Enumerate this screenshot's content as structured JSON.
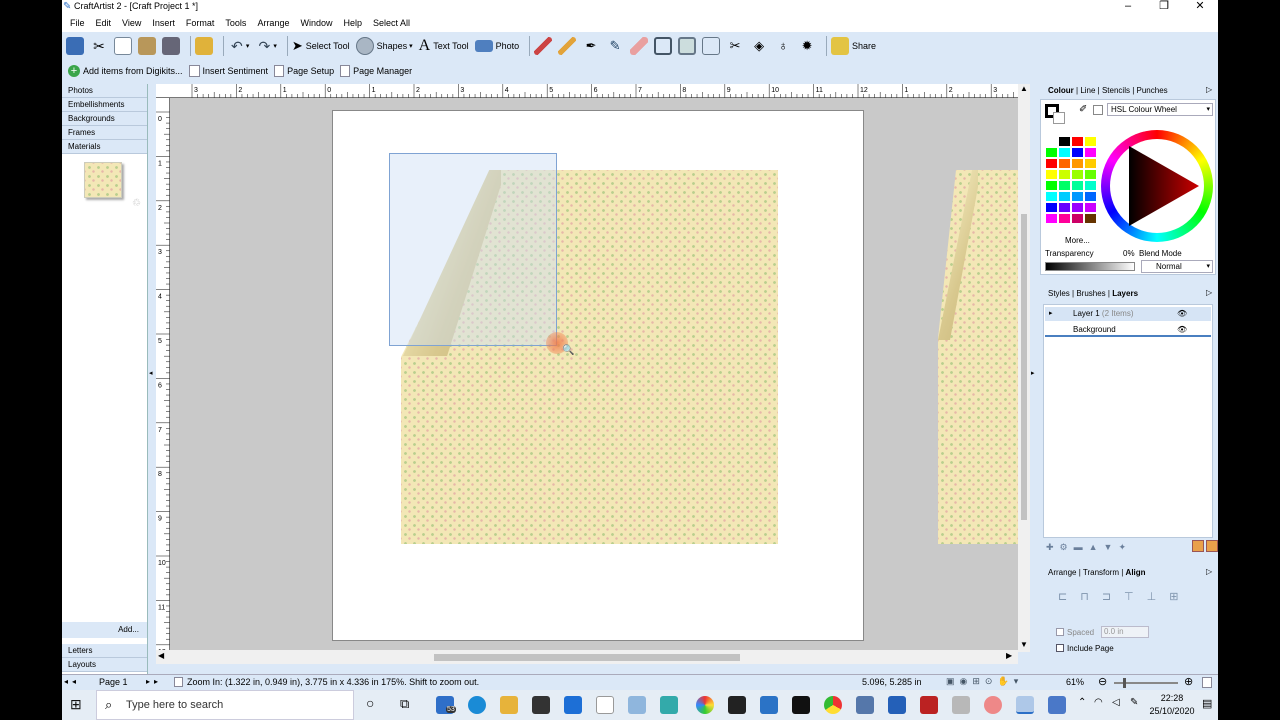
{
  "window": {
    "title": "CraftArtist 2 - [Craft Project 1 *]",
    "min": "–",
    "max": "❐",
    "close": "✕"
  },
  "menu": [
    "File",
    "Edit",
    "View",
    "Insert",
    "Format",
    "Tools",
    "Arrange",
    "Window",
    "Help",
    "Select All"
  ],
  "toolbar": {
    "select_tool": "Select Tool",
    "shapes": "Shapes",
    "text_tool": "Text Tool",
    "photo": "Photo",
    "share": "Share"
  },
  "toolbar2": {
    "add_items": "Add items from Digikits...",
    "insert_sentiment": "Insert Sentiment",
    "page_setup": "Page Setup",
    "page_manager": "Page Manager"
  },
  "leftpanel": {
    "tabs_top": [
      "Photos",
      "Embellishments",
      "Backgrounds",
      "Frames",
      "Materials"
    ],
    "add": "Add...",
    "tabs_bottom": [
      "Letters",
      "Layouts"
    ]
  },
  "ruler": {
    "h_unit": "in",
    "h_labels": [
      "3",
      "2",
      "1",
      "0",
      "1",
      "2",
      "3",
      "4",
      "5",
      "6",
      "7",
      "8",
      "9",
      "10",
      "11",
      "12",
      "1",
      "2",
      "3"
    ],
    "v_labels": [
      "0",
      "1",
      "2",
      "3",
      "4",
      "5",
      "6",
      "7",
      "8",
      "9",
      "10",
      "11",
      "12"
    ]
  },
  "colour_panel": {
    "tabs": [
      "Colour",
      "Line",
      "Stencils",
      "Punches"
    ],
    "mode": "HSL Colour Wheel",
    "more": "More...",
    "transparency_label": "Transparency",
    "transparency_value": "0%",
    "blend_label": "Blend Mode",
    "blend_value": "Normal",
    "swatches": [
      "#ffffff",
      "#000000",
      "#ff0000",
      "#ffff00",
      "#00ff00",
      "#00ffff",
      "#0000ff",
      "#ff00ff",
      "#ff0000",
      "#ff6600",
      "#ff9900",
      "#ffcc00",
      "#ffff00",
      "#ccff00",
      "#99ff00",
      "#66ff00",
      "#00ff00",
      "#00ff66",
      "#00ff99",
      "#00ffcc",
      "#00ffff",
      "#00ccff",
      "#0099ff",
      "#0066ff",
      "#0000ff",
      "#6600ff",
      "#9900ff",
      "#cc00ff",
      "#ff00ff",
      "#ff0099",
      "#cc0066",
      "#663300"
    ]
  },
  "layers_panel": {
    "tabs": [
      "Styles",
      "Brushes",
      "Layers"
    ],
    "layer1": "Layer 1",
    "layer1_items": "(2 Items)",
    "background": "Background"
  },
  "align_panel": {
    "tabs": [
      "Arrange",
      "Transform",
      "Align"
    ],
    "spaced_label": "Spaced",
    "spaced_value": "0.0 in",
    "include_page": "Include Page"
  },
  "status": {
    "page": "Page 1",
    "hint": "Zoom In: (1.322 in, 0.949 in), 3.775 in x 4.336 in 175%. Shift to zoom out.",
    "coords": "5.096, 5.285 in",
    "zoom": "61%"
  },
  "taskbar": {
    "search_placeholder": "Type here to search",
    "mail_badge": "53",
    "time": "22:28",
    "date": "25/10/2020"
  }
}
